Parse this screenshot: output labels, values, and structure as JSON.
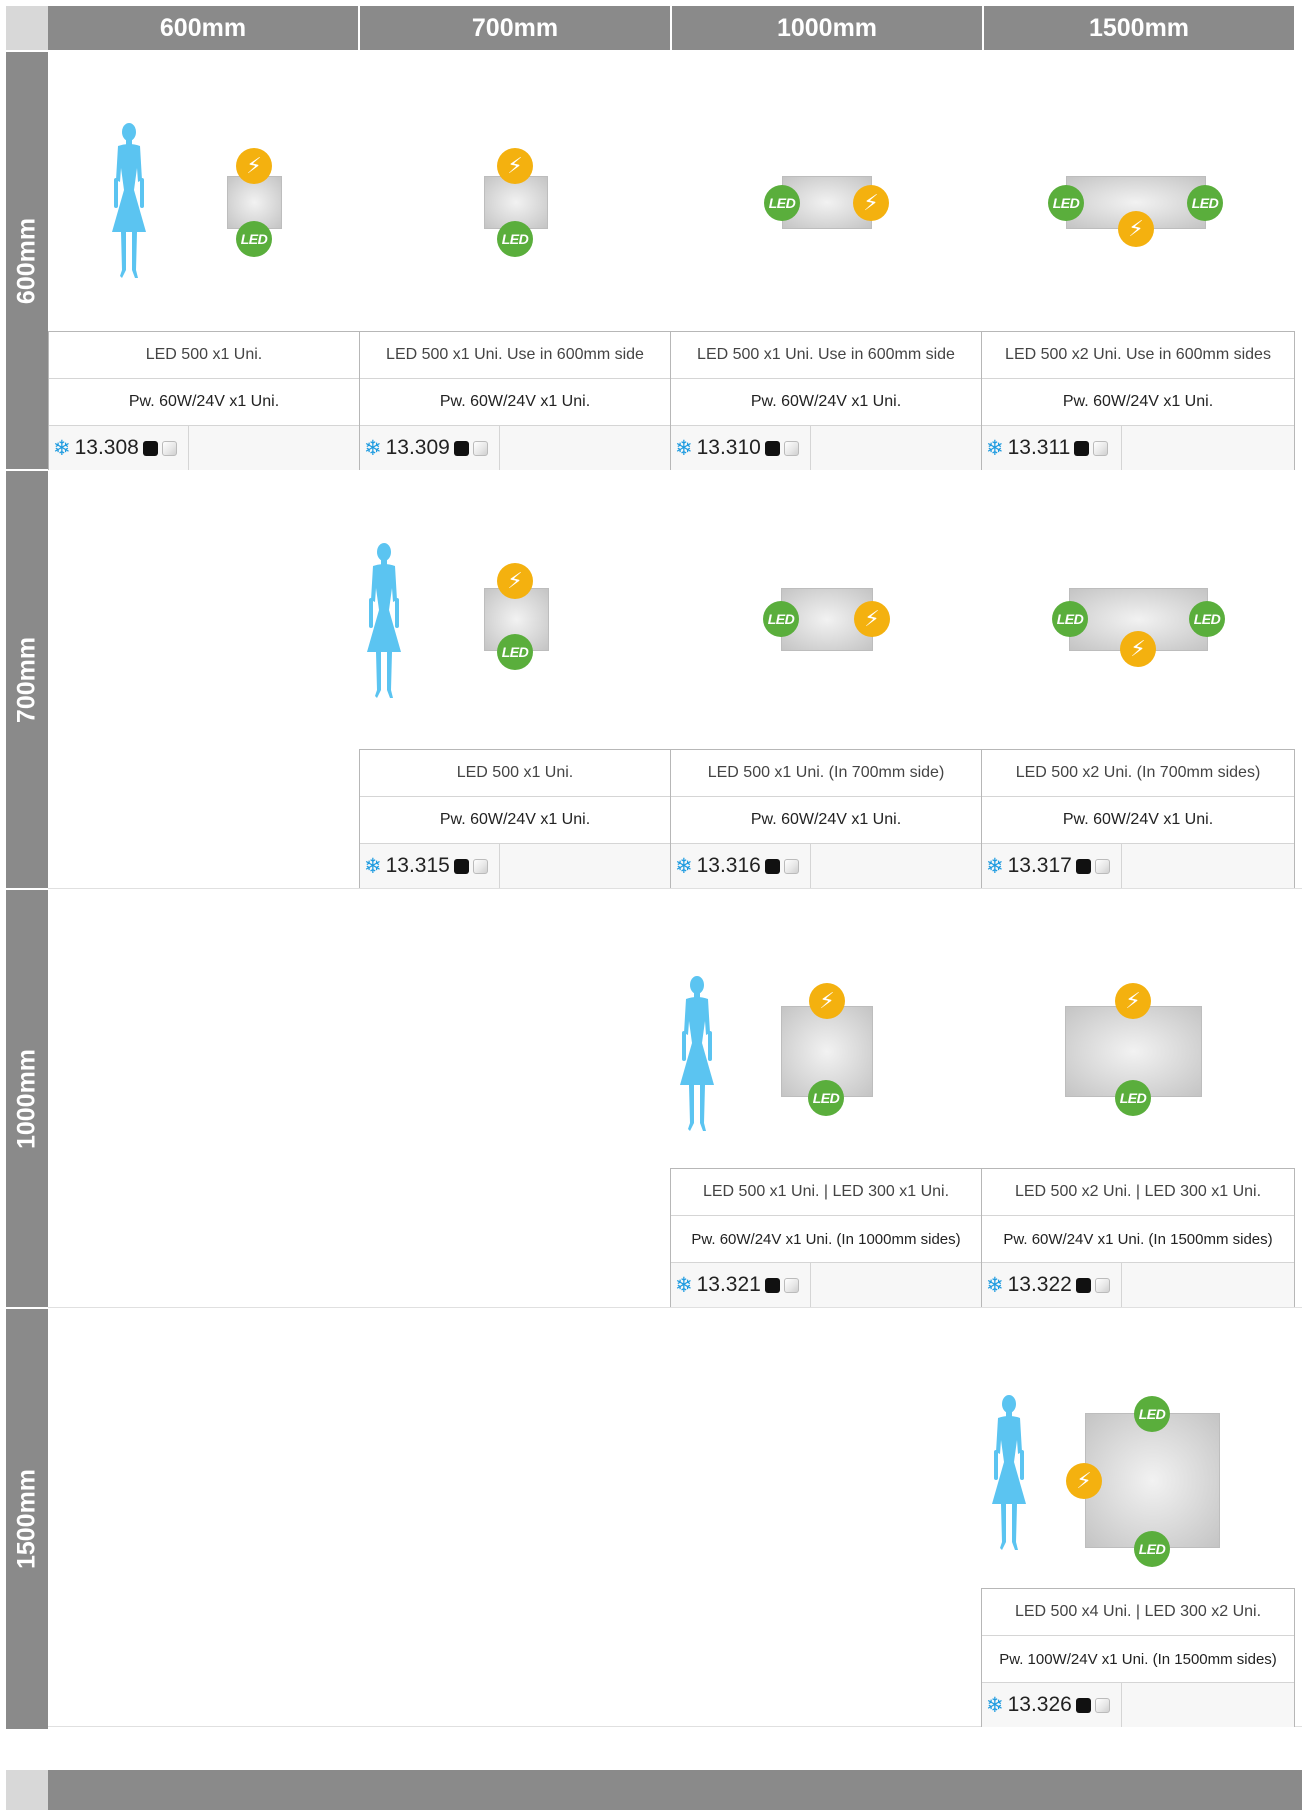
{
  "col_headers": [
    "600mm",
    "700mm",
    "1000mm",
    "1500mm"
  ],
  "row_headers": [
    "600mm",
    "700mm",
    "1000mm",
    "1500mm"
  ],
  "icons": {
    "led_label": "LED",
    "snowflake": "snowflake-icon",
    "power": "lightning-icon"
  },
  "colors": {
    "header_gray": "#8a8a8a",
    "led_green": "#5aae3c",
    "power_yellow": "#f4b10f",
    "figure_blue": "#5bc4f1",
    "flake_blue": "#1e9be0"
  },
  "products": [
    {
      "led": "LED 500 x1 Uni.",
      "power": "Pw. 60W/24V x1 Uni.",
      "code": "13.308"
    },
    {
      "led": "LED 500 x1 Uni.  Use in 600mm side",
      "power": "Pw. 60W/24V x1 Uni.",
      "code": "13.309"
    },
    {
      "led": "LED 500 x1 Uni.  Use in 600mm side",
      "power": "Pw. 60W/24V x1 Uni.",
      "code": "13.310"
    },
    {
      "led": "LED 500 x2 Uni.  Use in 600mm sides",
      "power": "Pw. 60W/24V x1 Uni.",
      "code": "13.311"
    },
    {
      "led": "LED 500 x1 Uni.",
      "power": "Pw. 60W/24V x1 Uni.",
      "code": "13.315"
    },
    {
      "led": "LED 500 x1 Uni.  (In 700mm side)",
      "power": "Pw. 60W/24V x1 Uni.",
      "code": "13.316"
    },
    {
      "led": "LED 500 x2 Uni.  (In 700mm sides)",
      "power": "Pw. 60W/24V x1 Uni.",
      "code": "13.317"
    },
    {
      "led": "LED 500 x1 Uni. | LED 300 x1 Uni.",
      "power": "Pw. 60W/24V x1 Uni.   (In 1000mm sides)",
      "code": "13.321"
    },
    {
      "led": "LED 500 x2 Uni. | LED 300 x1 Uni.",
      "power": "Pw. 60W/24V x1 Uni.   (In 1500mm sides)",
      "code": "13.322"
    },
    {
      "led": "LED 500 x4 Uni. | LED 300 x2 Uni.",
      "power": "Pw. 100W/24V x1 Uni.   (In 1500mm sides)",
      "code": "13.326"
    }
  ]
}
